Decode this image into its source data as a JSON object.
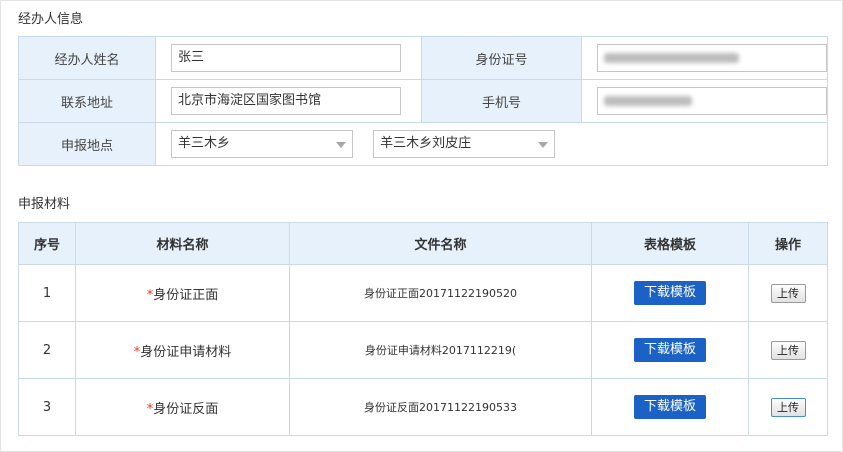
{
  "applicant_section": {
    "title": "经办人信息",
    "name_label": "经办人姓名",
    "name_value": "张三",
    "id_label": "身份证号",
    "address_label": "联系地址",
    "address_value": "北京市海淀区国家图书馆",
    "phone_label": "手机号",
    "location_label": "申报地点",
    "town_select": "羊三木乡",
    "village_select": "羊三木乡刘皮庄"
  },
  "materials_section": {
    "title": "申报材料",
    "columns": [
      "序号",
      "材料名称",
      "文件名称",
      "表格模板",
      "操作"
    ],
    "required_mark": "*",
    "template_button": "下载模板",
    "upload_button": "上传",
    "rows": [
      {
        "index": "1",
        "name": "身份证正面",
        "file": "身份证正面20171122190520"
      },
      {
        "index": "2",
        "name": "身份证申请材料",
        "file": "身份证申请材料2017112219("
      },
      {
        "index": "3",
        "name": "身份证反面",
        "file": "身份证反面20171122190533"
      }
    ]
  },
  "colors": {
    "label_bg": "#e7f1fb",
    "border": "#c9d9e8",
    "button_blue": "#1a62c5",
    "required": "#ee3322"
  }
}
